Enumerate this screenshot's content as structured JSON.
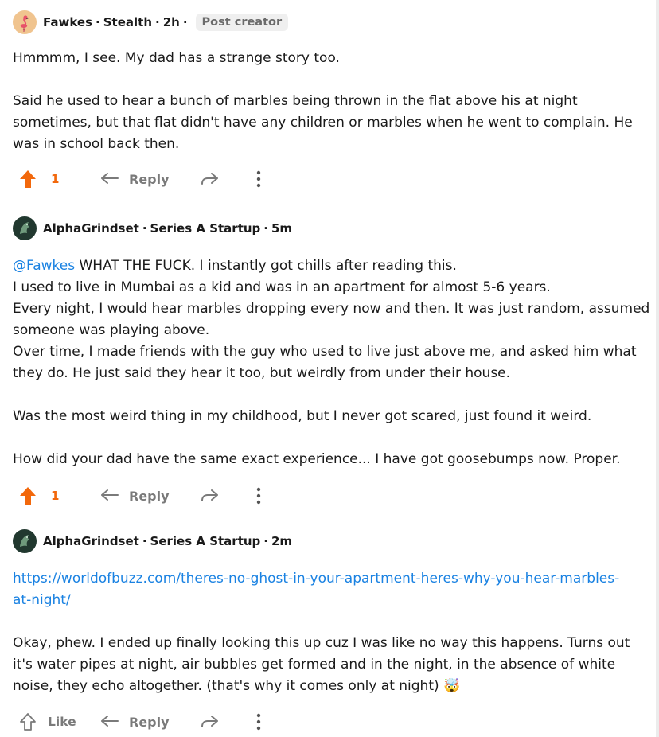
{
  "comments": [
    {
      "author": "Fawkes",
      "company": "Stealth",
      "time": "2h",
      "badge": "Post creator",
      "paragraphs": [
        "Hmmmm, I see. My dad has a strange story too.",
        "Said he used to hear a bunch of marbles being thrown in the flat above his at night sometimes, but that flat didn't have any children or marbles when he went to complain. He was in school back then."
      ],
      "vote_count": "1",
      "reply_label": "Reply"
    },
    {
      "author": "AlphaGrindset",
      "company": "Series A Startup",
      "time": "5m",
      "mention": "@Fawkes",
      "first_line": " WHAT THE FUCK. I instantly got chills after reading this.",
      "lines": [
        "I used to live in Mumbai as a kid and was in an apartment for almost 5-6 years.",
        "Every night, I would hear marbles dropping every now and then. It was just random, assumed someone was playing above.",
        "Over time, I made friends with the guy who used to live just above me, and asked him what they do. He just said they hear it too, but weirdly from under their house."
      ],
      "paragraph2": "Was the most weird thing in my childhood, but I never got scared, just found it weird.",
      "paragraph3": "How did your dad have the same exact experience... I have got goosebumps now. Proper.",
      "vote_count": "1",
      "reply_label": "Reply"
    },
    {
      "author": "AlphaGrindset",
      "company": "Series A Startup",
      "time": "2m",
      "link": "https://worldofbuzz.com/theres-no-ghost-in-your-apartment-heres-why-you-hear-marbles-at-night/",
      "paragraph": "Okay, phew. I ended up finally looking this up cuz I was like no way this happens. Turns out it's water pipes at night, air bubbles get formed and in the night, in the absence of white noise, they echo altogether. (that's why it comes only at night) 🤯",
      "like_label": "Like",
      "reply_label": "Reply"
    }
  ],
  "colors": {
    "upvote": "#f2680c",
    "link": "#1a82e2",
    "muted": "#7a7a7a"
  }
}
